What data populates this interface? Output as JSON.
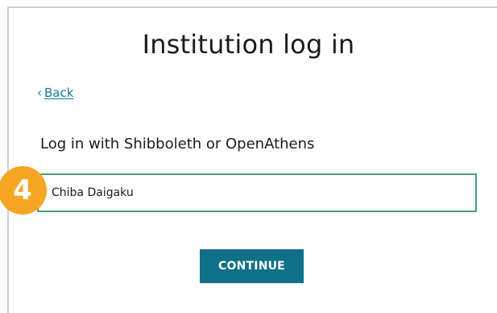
{
  "page": {
    "title": "Institution log in",
    "back_label": "Back",
    "subheading": "Log in with Shibboleth or OpenAthens"
  },
  "form": {
    "institution_value": "Chiba Daigaku",
    "continue_label": "CONTINUE"
  },
  "annotation": {
    "step_number": "4"
  },
  "colors": {
    "link": "#127a94",
    "button": "#0f7088",
    "input_border": "#4e9a74",
    "badge": "#f5a623"
  },
  "icons": {
    "back": "chevron-left-icon"
  }
}
